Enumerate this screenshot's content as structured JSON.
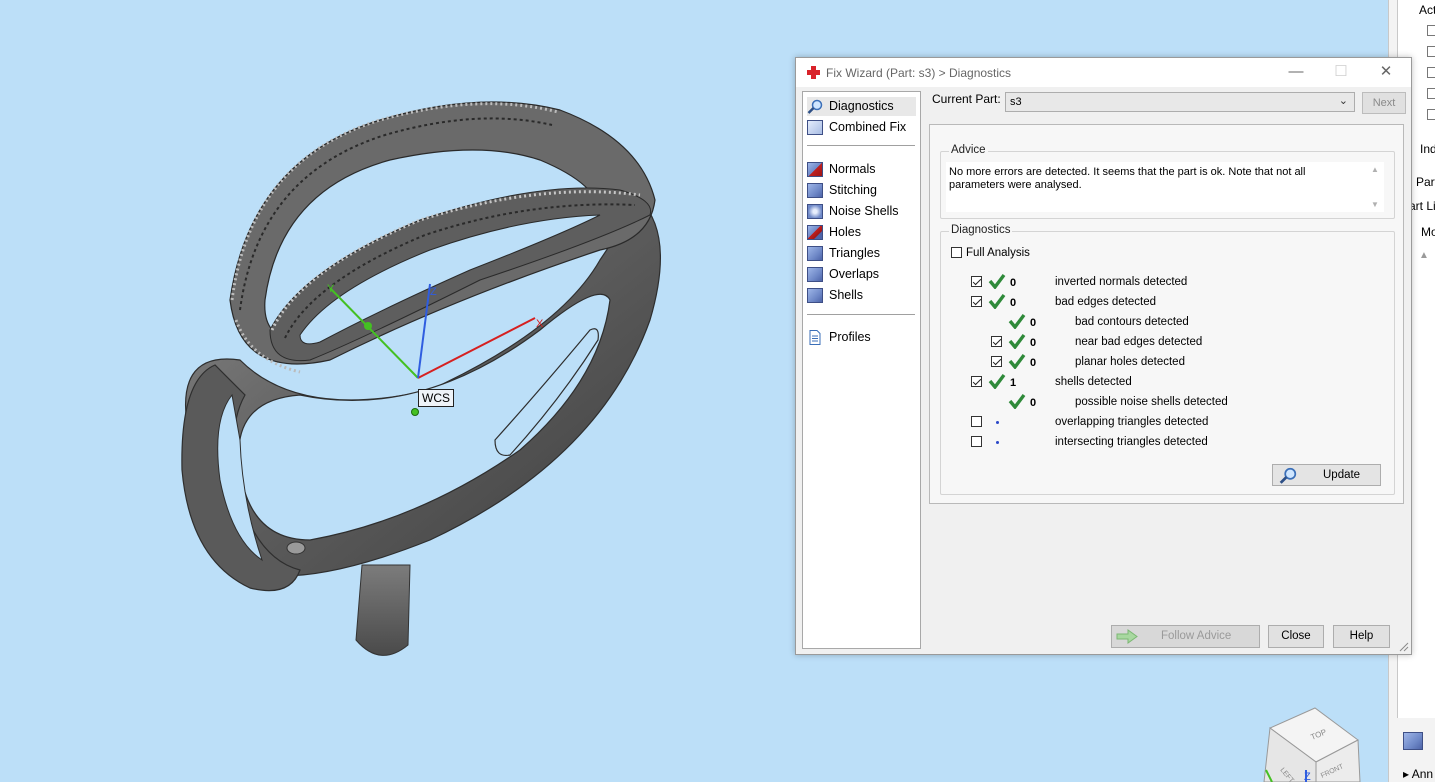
{
  "dialog": {
    "title": "Fix Wizard (Part: s3) > Diagnostics",
    "window_buttons": {
      "minimize": "—",
      "maximize": "☐",
      "close": "✕"
    }
  },
  "nav": {
    "items": [
      {
        "label": "Diagnostics",
        "icon": "magnifier-icon",
        "selected": true
      },
      {
        "label": "Combined Fix",
        "icon": "combined-fix-icon"
      },
      {
        "label": "Normals",
        "icon": "normals-cube-icon"
      },
      {
        "label": "Stitching",
        "icon": "stitching-cube-icon"
      },
      {
        "label": "Noise Shells",
        "icon": "noise-shells-icon"
      },
      {
        "label": "Holes",
        "icon": "holes-cube-icon"
      },
      {
        "label": "Triangles",
        "icon": "triangles-cube-icon"
      },
      {
        "label": "Overlaps",
        "icon": "overlaps-cube-icon"
      },
      {
        "label": "Shells",
        "icon": "shells-cube-icon"
      },
      {
        "label": "Profiles",
        "icon": "document-icon"
      }
    ]
  },
  "current_part": {
    "label": "Current Part:",
    "value": "s3"
  },
  "next_label": "Next",
  "advice": {
    "title": "Advice",
    "text": "No more errors are detected. It seems that the part is ok. Note that not all parameters were analysed."
  },
  "diagnostics": {
    "title": "Diagnostics",
    "full_analysis_label": "Full Analysis",
    "full_analysis_checked": false,
    "rows": [
      {
        "checkbox": true,
        "checked": true,
        "status": "ok",
        "count": "0",
        "label": "inverted normals detected",
        "indent": 0
      },
      {
        "checkbox": true,
        "checked": true,
        "status": "ok",
        "count": "0",
        "label": "bad edges detected",
        "indent": 0
      },
      {
        "checkbox": false,
        "checked": false,
        "status": "ok",
        "count": "0",
        "label": "bad contours detected",
        "indent": 1
      },
      {
        "checkbox": true,
        "checked": true,
        "status": "ok",
        "count": "0",
        "label": "near bad edges detected",
        "indent": 1
      },
      {
        "checkbox": true,
        "checked": true,
        "status": "ok",
        "count": "0",
        "label": "planar holes detected",
        "indent": 1
      },
      {
        "checkbox": true,
        "checked": true,
        "status": "ok",
        "count": "1",
        "label": "shells detected",
        "indent": 0
      },
      {
        "checkbox": false,
        "checked": false,
        "status": "ok",
        "count": "0",
        "label": "possible noise shells detected",
        "indent": 1
      },
      {
        "checkbox": true,
        "checked": false,
        "status": "pending",
        "count": "",
        "label": "overlapping triangles detected",
        "indent": 0
      },
      {
        "checkbox": true,
        "checked": false,
        "status": "pending",
        "count": "",
        "label": "intersecting triangles detected",
        "indent": 0
      }
    ],
    "update_label": "Update"
  },
  "buttons": {
    "follow_advice": "Follow Advice",
    "close": "Close",
    "help": "Help"
  },
  "viewport": {
    "wcs_label": "WCS",
    "axes": {
      "x": "X",
      "y": "Y",
      "z": "Z"
    },
    "navcube": {
      "top": "TOP",
      "left": "LEFT",
      "front": "FRONT",
      "z": "Z"
    }
  },
  "right_panel": {
    "texts": [
      "Act",
      "Ind",
      "Part",
      "art Li",
      "Mo",
      "Ann"
    ]
  },
  "colors": {
    "background": "#bcdff8",
    "check_green": "#2f8a3a",
    "x_axis": "#d62020",
    "y_axis": "#44c022",
    "z_axis": "#2f5de0"
  }
}
